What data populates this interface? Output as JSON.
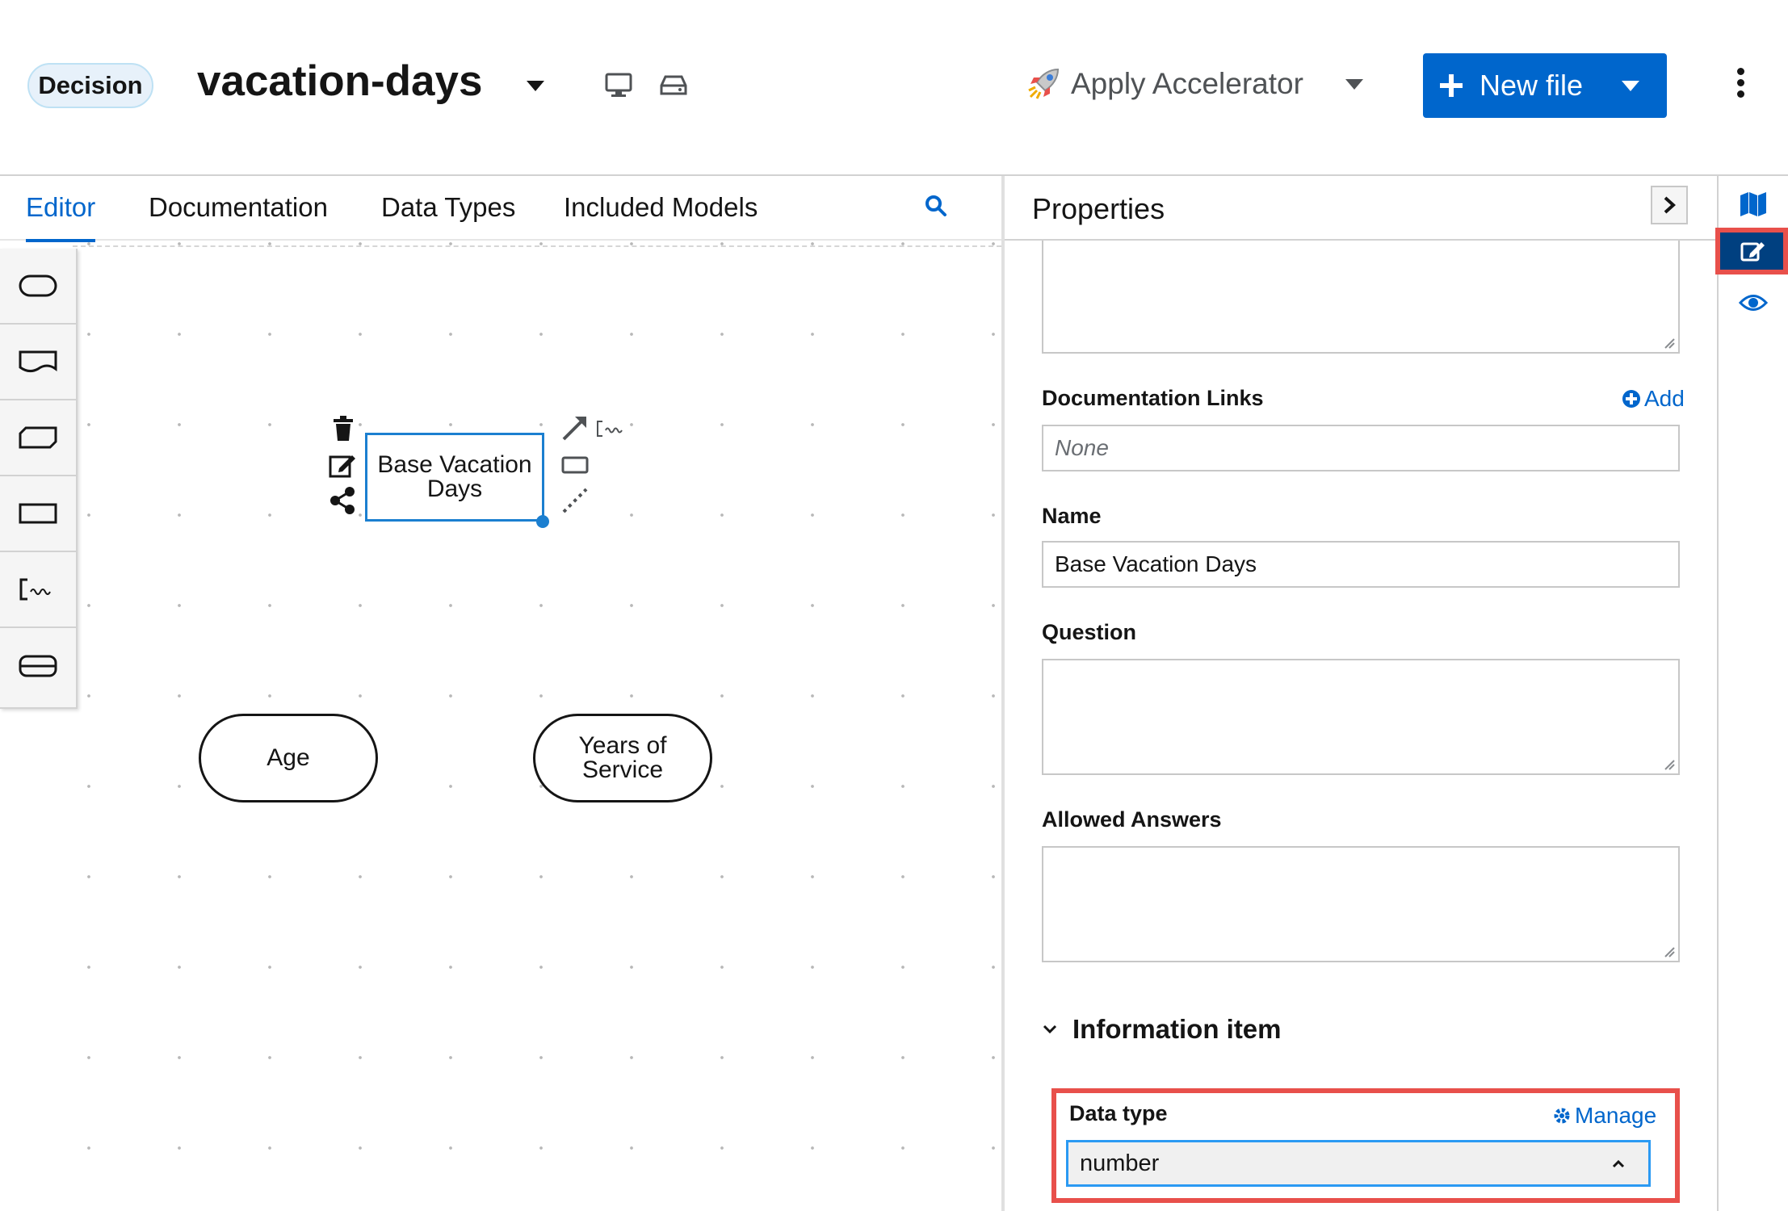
{
  "header": {
    "badge": "Decision",
    "file_title": "vacation-days",
    "accelerator_label": "Apply Accelerator",
    "new_file_label": "New file"
  },
  "editor_tabs": [
    {
      "label": "Editor",
      "active": true
    },
    {
      "label": "Documentation",
      "active": false
    },
    {
      "label": "Data Types",
      "active": false
    },
    {
      "label": "Included Models",
      "active": false
    }
  ],
  "canvas": {
    "nodes": [
      {
        "label": "Base Vacation Days",
        "shape": "decision",
        "selected": true
      },
      {
        "label": "Age",
        "shape": "input-data"
      },
      {
        "label": "Years of Service",
        "shape": "input-data"
      }
    ]
  },
  "properties": {
    "title": "Properties",
    "documentation_links": {
      "label": "Documentation Links",
      "add_label": "Add",
      "placeholder": "None"
    },
    "name": {
      "label": "Name",
      "value": "Base Vacation Days"
    },
    "question": {
      "label": "Question",
      "value": ""
    },
    "allowed_answers": {
      "label": "Allowed Answers",
      "value": ""
    },
    "information_item": {
      "section_label": "Information item",
      "data_type_label": "Data type",
      "manage_label": "Manage",
      "data_type_value": "number"
    }
  },
  "colors": {
    "accent": "#0066cc",
    "highlight": "#e8504b",
    "selection": "#1b7fd0",
    "rail_active": "#004080"
  }
}
